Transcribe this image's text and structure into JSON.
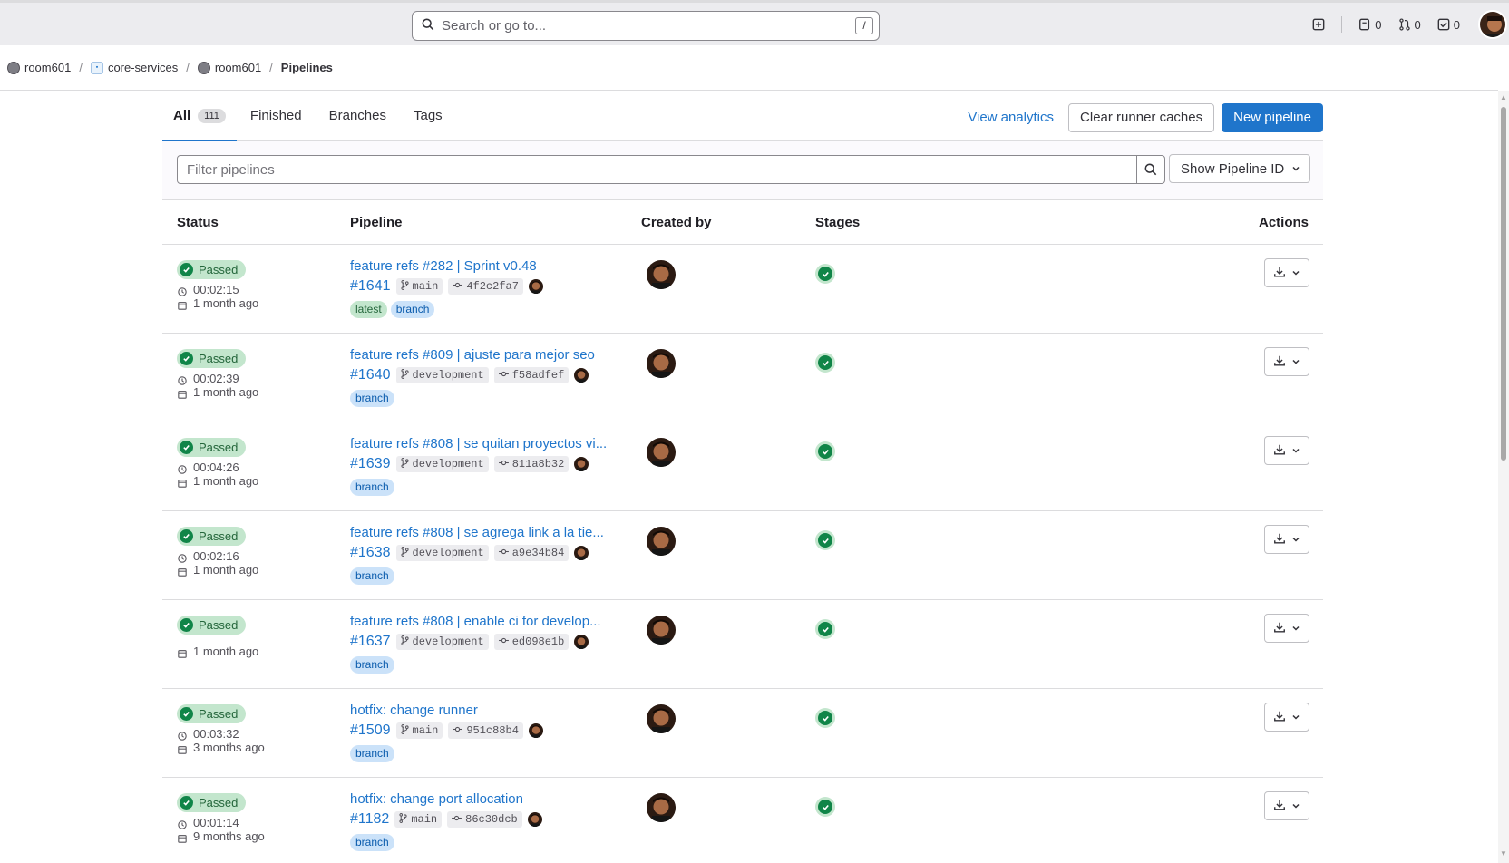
{
  "header": {
    "search_placeholder": "Search or go to...",
    "search_shortcut": "/",
    "issues_count": "0",
    "mr_count": "0",
    "todo_count": "0"
  },
  "breadcrumb": {
    "items": [
      "room601",
      "core-services",
      "room601",
      "Pipelines"
    ]
  },
  "tabs": {
    "all": "All",
    "all_count": "111",
    "finished": "Finished",
    "branches": "Branches",
    "tags": "Tags"
  },
  "actions": {
    "view_analytics": "View analytics",
    "clear_caches": "Clear runner caches",
    "new_pipeline": "New pipeline"
  },
  "filter": {
    "placeholder": "Filter pipelines",
    "dropdown": "Show Pipeline ID"
  },
  "table": {
    "headers": [
      "Status",
      "Pipeline",
      "Created by",
      "Stages",
      "Actions"
    ],
    "rows": [
      {
        "status": "Passed",
        "duration": "00:02:15",
        "finished": "1 month ago",
        "title": "feature refs #282 | Sprint v0.48",
        "id": "#1641",
        "ref": "main",
        "sha": "4f2c2fa7",
        "tags": [
          "latest",
          "branch"
        ]
      },
      {
        "status": "Passed",
        "duration": "00:02:39",
        "finished": "1 month ago",
        "title": "feature refs #809 | ajuste para mejor seo",
        "id": "#1640",
        "ref": "development",
        "sha": "f58adfef",
        "tags": [
          "branch"
        ]
      },
      {
        "status": "Passed",
        "duration": "00:04:26",
        "finished": "1 month ago",
        "title": "feature refs #808 | se quitan proyectos vi...",
        "id": "#1639",
        "ref": "development",
        "sha": "811a8b32",
        "tags": [
          "branch"
        ]
      },
      {
        "status": "Passed",
        "duration": "00:02:16",
        "finished": "1 month ago",
        "title": "feature refs #808 | se agrega link a la tie...",
        "id": "#1638",
        "ref": "development",
        "sha": "a9e34b84",
        "tags": [
          "branch"
        ]
      },
      {
        "status": "Passed",
        "duration": "",
        "finished": "1 month ago",
        "title": "feature refs #808 | enable ci for develop...",
        "id": "#1637",
        "ref": "development",
        "sha": "ed098e1b",
        "tags": [
          "branch"
        ]
      },
      {
        "status": "Passed",
        "duration": "00:03:32",
        "finished": "3 months ago",
        "title": "hotfix: change runner",
        "id": "#1509",
        "ref": "main",
        "sha": "951c88b4",
        "tags": [
          "branch"
        ]
      },
      {
        "status": "Passed",
        "duration": "00:01:14",
        "finished": "9 months ago",
        "title": "hotfix: change port allocation",
        "id": "#1182",
        "ref": "main",
        "sha": "86c30dcb",
        "tags": [
          "branch"
        ]
      }
    ]
  },
  "colors": {
    "link": "#1f75cb",
    "success": "#108548",
    "success_bg": "#c3e6cd",
    "branch_bg": "#cbe2f9"
  }
}
